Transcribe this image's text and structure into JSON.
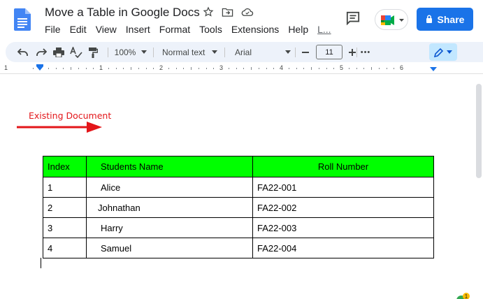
{
  "header": {
    "doc_title": "Move a Table in Google Docs",
    "menu": [
      "File",
      "Edit",
      "View",
      "Insert",
      "Format",
      "Tools",
      "Extensions",
      "Help",
      "L..."
    ],
    "share_label": "Share"
  },
  "toolbar": {
    "zoom": "100%",
    "style": "Normal text",
    "font": "Arial",
    "font_size": "11",
    "more": "•••"
  },
  "ruler": {
    "numbers": [
      "1",
      "1",
      "2",
      "3",
      "4",
      "5",
      "6"
    ]
  },
  "document": {
    "annotation": "Existing Document",
    "table": {
      "headers": [
        "Index",
        "Students Name",
        "Roll Number"
      ],
      "rows": [
        [
          "1",
          "Alice",
          "FA22-001"
        ],
        [
          "2",
          "Johnathan",
          "FA22-002"
        ],
        [
          "3",
          "Harry",
          "FA22-003"
        ],
        [
          "4",
          "Samuel",
          "FA22-004"
        ]
      ]
    }
  },
  "colors": {
    "accent": "#1a73e8",
    "table_header_bg": "#00ff00",
    "annotation": "#e3161a"
  },
  "icons": [
    "docs-logo-icon",
    "star-icon",
    "move-folder-icon",
    "cloud-saved-icon",
    "comment-icon",
    "meet-icon",
    "lock-icon",
    "undo-icon",
    "redo-icon",
    "print-icon",
    "spellcheck-icon",
    "paint-format-icon",
    "pencil-icon"
  ]
}
